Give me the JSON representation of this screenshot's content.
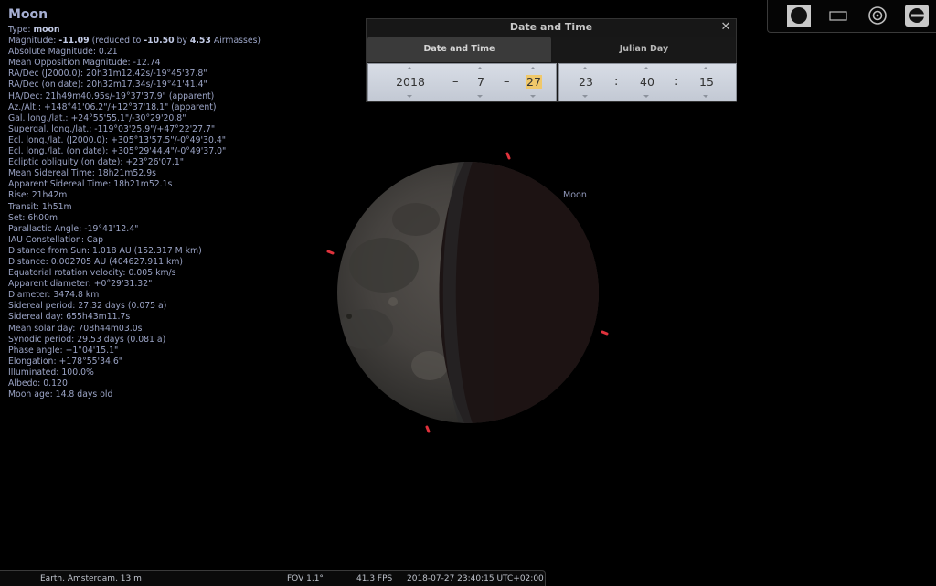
{
  "info": {
    "title": "Moon",
    "type_label": "Type: ",
    "type_value": "moon",
    "magnitude": {
      "prefix": "Magnitude: ",
      "value": "-11.09",
      "mid1": " (reduced to ",
      "reduced": "-10.50",
      "mid2": " by ",
      "airmass": "4.53",
      "suffix": " Airmasses)"
    },
    "lines": [
      "Absolute Magnitude: 0.21",
      "Mean Opposition Magnitude: -12.74",
      "RA/Dec (J2000.0): 20h31m12.42s/-19°45'37.8\"",
      "RA/Dec (on date): 20h32m17.34s/-19°41'41.4\"",
      "HA/Dec: 21h49m40.95s/-19°37'37.9\" (apparent)",
      "Az./Alt.: +148°41'06.2\"/+12°37'18.1\" (apparent)",
      "Gal. long./lat.: +24°55'55.1\"/-30°29'20.8\"",
      "Supergal. long./lat.: -119°03'25.9\"/+47°22'27.7\"",
      "Ecl. long./lat. (J2000.0): +305°13'57.5\"/-0°49'30.4\"",
      "Ecl. long./lat. (on date): +305°29'44.4\"/-0°49'37.0\"",
      "Ecliptic obliquity (on date): +23°26'07.1\"",
      "Mean Sidereal Time: 18h21m52.9s",
      "Apparent Sidereal Time: 18h21m52.1s",
      "Rise: 21h42m",
      "Transit: 1h51m",
      "Set: 6h00m",
      "Parallactic Angle: -19°41'12.4\"",
      "IAU Constellation: Cap",
      "Distance from Sun: 1.018 AU (152.317 M km)",
      "Distance: 0.002705 AU (404627.911 km)",
      "Equatorial rotation velocity: 0.005 km/s",
      "Apparent diameter: +0°29'31.32\"",
      "Diameter: 3474.8 km",
      "Sidereal period: 27.32 days (0.075 a)",
      "Sidereal day: 655h43m11.7s",
      "Mean solar day: 708h44m03.0s",
      "Synodic period: 29.53 days (0.081 a)",
      "Phase angle: +1°04'15.1\"",
      "Elongation: +178°55'34.6\"",
      "Illuminated: 100.0%",
      "Albedo: 0.120",
      "Moon age: 14.8 days old"
    ]
  },
  "sky": {
    "object_label": "Moon",
    "colors": {
      "marker": "#e0323c",
      "label": "#8f96b8",
      "shadow": "#1c1414"
    }
  },
  "dialog": {
    "title": "Date and Time",
    "close_icon": "close-icon",
    "tabs": [
      "Date and Time",
      "Julian Day"
    ],
    "date": {
      "year": "2018",
      "month": "7",
      "day": "27",
      "separator": "–"
    },
    "time": {
      "hour": "23",
      "minute": "40",
      "second": "15",
      "separator": ":"
    }
  },
  "toolbar": {
    "buttons": [
      "moon-disk-icon",
      "frame-icon",
      "target-icon",
      "telescope-icon"
    ]
  },
  "status": {
    "location": "Earth, Amsterdam, 13 m",
    "fov": "FOV 1.1°",
    "fps": "41.3 FPS",
    "datetime": "2018-07-27 23:40:15 UTC+02:00"
  }
}
